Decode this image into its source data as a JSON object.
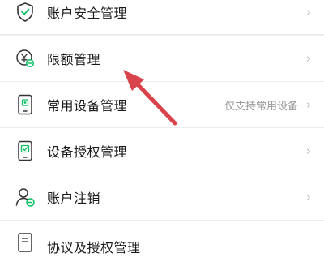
{
  "menu": {
    "items": [
      {
        "label": "账户安全管理",
        "icon": "shield-check-icon"
      },
      {
        "label": "限额管理",
        "icon": "yen-limit-icon"
      },
      {
        "label": "常用设备管理",
        "icon": "phone-device-icon",
        "hint": "仅支持常用设备"
      },
      {
        "label": "设备授权管理",
        "icon": "phone-authorize-icon"
      },
      {
        "label": "账户注销",
        "icon": "user-remove-icon"
      },
      {
        "label": "协议及授权管理",
        "icon": "document-icon"
      }
    ],
    "chevron": "›"
  },
  "colors": {
    "accent": "#07c160",
    "arrow": "#d9434b"
  }
}
